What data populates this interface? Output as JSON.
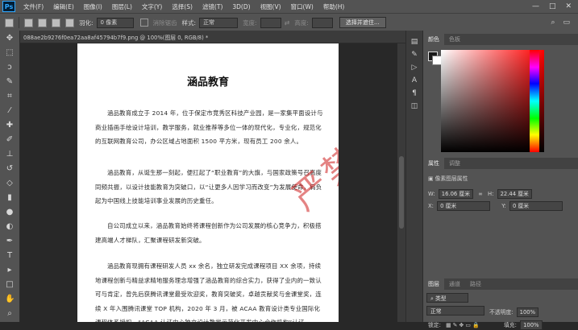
{
  "app": {
    "logo_text": "Ps"
  },
  "menu": [
    "文件(F)",
    "编辑(E)",
    "图像(I)",
    "图层(L)",
    "文字(Y)",
    "选择(S)",
    "滤镜(T)",
    "3D(D)",
    "视图(V)",
    "窗口(W)",
    "帮助(H)"
  ],
  "window_controls": [
    "—",
    "□",
    "✕"
  ],
  "options_bar": {
    "feather_label": "羽化:",
    "feather_value": "0 像素",
    "antialias_label": "消除锯齿",
    "style_label": "样式:",
    "style_value": "正常",
    "width_label": "宽度:",
    "height_label": "高度:",
    "select_mask_button": "选择并遮住..."
  },
  "document": {
    "tab_label": "088ae2b9276f0ea72aa8af45794b7f9.png @ 100%(图层 0, RGB/8) *",
    "title": "涵品教育",
    "paragraphs": [
      "涵品教育成立于 2014 年，位于保定市竞秀区科技产业园，是一家集平面设计与商业插画手绘设计培训，教学服务，就业推荐等多位一体的现代化，专业化，规范化的互联网教育公司，办公区域占地面积 1500 平方米，现有员工 200 余人。",
      "涵品教育，从诞生那一刻起，便扛起了“职业教育”的大旗，与国家政策号召高度同频共振，以设计技能教育为突破口，以“让更多人因学习而改变”为发展使命，肩负起为中国线上技能培训事业发展的历史重任。",
      "自公司成立以来，涵品教育始终将课程创新作为公司发展的核心竞争力，积极搭建高端人才梯队，汇聚课程研发新突破。",
      "涵品教育现拥有课程研发人员 xx 余名，独立研发完成课程项目 XX 余项，持续地课程创新与精益求精地服务理念增强了涵品教育的综合实力，获得了业内的一致认可与肯定，曾先后获腾讯课堂最受欢迎奖，教育突破奖，卓越贡献奖与金课堂奖，连续 X 年入围腾讯课堂 TOP 机构，2020 年 3 月，被 ACAA 教育设计类专业国际化课程体系授权，“ACAA 认证中心独立设计教学示范化开发中心合作机构”认证。"
    ],
    "watermark": "严禁复制"
  },
  "panels": {
    "color_tabs": [
      "颜色",
      "色板"
    ],
    "properties_tabs": [
      "属性",
      "调整"
    ],
    "properties_title": "像素图层属性",
    "w_label": "W:",
    "w_value": "16.06 厘米",
    "h_label": "H:",
    "h_value": "22.44 厘米",
    "x_label": "X:",
    "x_value": "0 厘米",
    "y_label": "Y:",
    "y_value": "0 厘米",
    "layers_tabs": [
      "图层",
      "通道",
      "路径"
    ],
    "kind_label": "类型",
    "blend_mode": "正常",
    "opacity_label": "不透明度:",
    "opacity_value": "100%",
    "lock_label": "锁定:",
    "fill_label": "填充:",
    "fill_value": "100%"
  },
  "colors": {
    "foreground": "#1a1a1a",
    "background": "#ffffff",
    "ui_dark": "#282828",
    "ui_panel": "#535353"
  }
}
